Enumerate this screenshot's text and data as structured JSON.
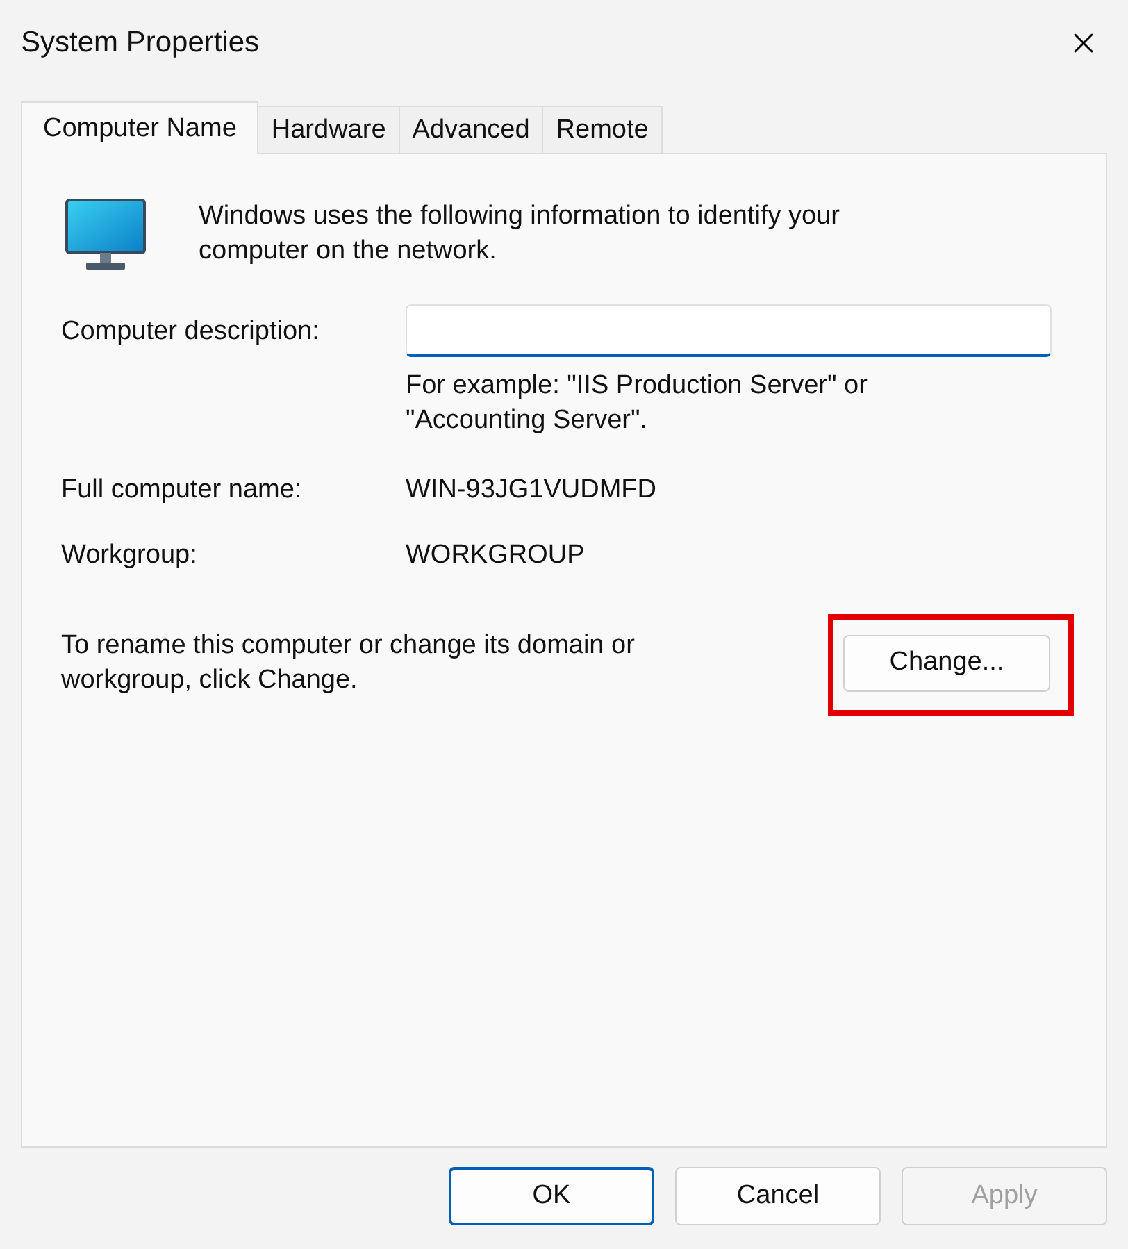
{
  "window": {
    "title": "System Properties"
  },
  "tabs": [
    {
      "label": "Computer Name",
      "selected": true
    },
    {
      "label": "Hardware",
      "selected": false
    },
    {
      "label": "Advanced",
      "selected": false
    },
    {
      "label": "Remote",
      "selected": false
    }
  ],
  "intro": "Windows uses the following information to identify your computer on the network.",
  "description": {
    "label": "Computer description:",
    "focused": true
  },
  "example": "For example: \"IIS Production Server\" or \"Accounting Server\".",
  "info": [
    {
      "label": "Full computer name:",
      "value": "WIN-93JG1VUDMFD"
    },
    {
      "label": "Workgroup:",
      "value": "WORKGROUP"
    }
  ],
  "rename": {
    "text": "To rename this computer or change its domain or workgroup, click Change.",
    "button": "Change...",
    "highlighted": true
  },
  "buttons": [
    {
      "label": "OK",
      "default": true,
      "disabled": false
    },
    {
      "label": "Cancel",
      "default": false,
      "disabled": false
    },
    {
      "label": "Apply",
      "default": false,
      "disabled": true
    }
  ]
}
